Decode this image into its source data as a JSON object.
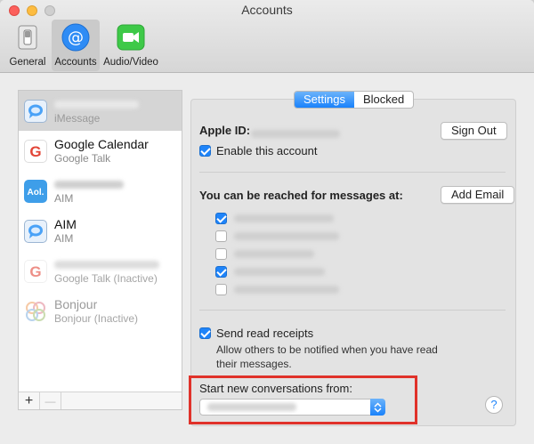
{
  "window": {
    "title": "Accounts"
  },
  "toolbar": {
    "items": [
      {
        "label": "General",
        "icon": "switch-icon"
      },
      {
        "label": "Accounts",
        "icon": "at-icon",
        "active": true
      },
      {
        "label": "Audio/Video",
        "icon": "video-camera-icon"
      }
    ]
  },
  "sidebar": {
    "items": [
      {
        "name": "",
        "subtitle": "iMessage",
        "icon": "imessage-icon",
        "selected": true
      },
      {
        "name": "Google Calendar",
        "subtitle": "Google Talk",
        "icon": "google-icon"
      },
      {
        "name": "",
        "subtitle": "AIM",
        "icon": "aol-icon"
      },
      {
        "name": "AIM",
        "subtitle": "AIM",
        "icon": "aim-icon"
      },
      {
        "name": "",
        "subtitle": "Google Talk (Inactive)",
        "icon": "google-icon",
        "inactive": true
      },
      {
        "name": "Bonjour",
        "subtitle": "Bonjour (Inactive)",
        "icon": "bonjour-icon",
        "inactive": true
      }
    ],
    "add_label": "+",
    "remove_label": "—"
  },
  "tabs": {
    "settings": "Settings",
    "blocked": "Blocked"
  },
  "account": {
    "apple_id_label": "Apple ID:",
    "sign_out": "Sign Out",
    "enable_label": "Enable this account",
    "enable_checked": true
  },
  "reach": {
    "label": "You can be reached for messages at:",
    "add_email": "Add Email",
    "addresses": [
      {
        "checked": true
      },
      {
        "checked": false
      },
      {
        "checked": false
      },
      {
        "checked": true
      },
      {
        "checked": false
      }
    ]
  },
  "receipts": {
    "label": "Send read receipts",
    "checked": true,
    "description_line1": "Allow others to be notified when you have read",
    "description_line2": "their messages."
  },
  "start_from": {
    "label": "Start new conversations from:"
  },
  "help_label": "?",
  "colors": {
    "accent": "#1f84f9",
    "highlight": "#e0322a"
  }
}
